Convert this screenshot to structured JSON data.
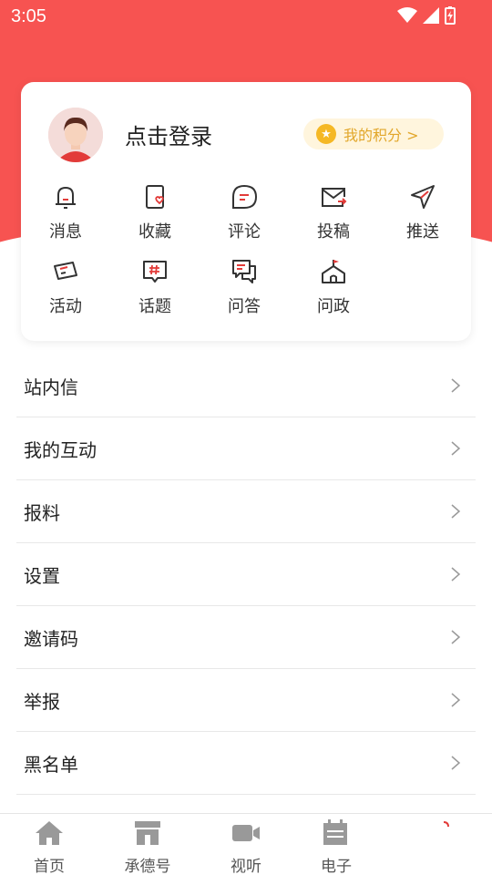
{
  "status": {
    "time": "3:05"
  },
  "profile": {
    "login_text": "点击登录",
    "points_label": "我的积分 >"
  },
  "grid": {
    "row1": [
      "消息",
      "收藏",
      "评论",
      "投稿",
      "推送"
    ],
    "row2": [
      "活动",
      "话题",
      "问答",
      "问政"
    ]
  },
  "menu": [
    "站内信",
    "我的互动",
    "报料",
    "设置",
    "邀请码",
    "举报",
    "黑名单"
  ],
  "tabs": [
    "首页",
    "承德号",
    "视听",
    "电子"
  ],
  "colors": {
    "brand_red": "#f75351",
    "points_gold": "#e2a72b"
  }
}
